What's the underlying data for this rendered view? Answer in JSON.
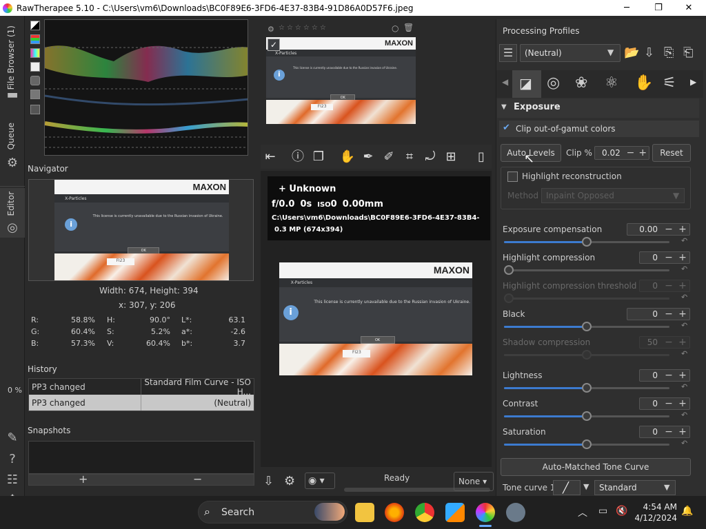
{
  "window": {
    "title": "RawTherapee 5.10 - C:\\Users\\vm6\\Downloads\\BC0F89E6-3FD6-4E37-83B4-91D86A0D57F6.jpeg",
    "minimize": "─",
    "maximize": "❐",
    "close": "✕"
  },
  "vtabs": {
    "file_browser": "File Browser (1)",
    "queue": "Queue",
    "editor": "Editor",
    "zoom_percent": "0 %"
  },
  "navigator": {
    "title": "Navigator",
    "size_text": "Width: 674, Height: 394",
    "coords_text": "x: 307, y: 206",
    "r_label": "R:",
    "r_value": "58.8%",
    "g_label": "G:",
    "g_value": "60.4%",
    "b_label": "B:",
    "b_value": "57.3%",
    "h_label": "H:",
    "h_value": "90.0°",
    "s_label": "S:",
    "s_value": "5.2%",
    "v_label": "V:",
    "v_value": "60.4%",
    "l_label": "L*:",
    "l_value": "63.1",
    "a_label": "a*:",
    "a_value": "-2.6",
    "bb_label": "b*:",
    "bb_value": "3.7"
  },
  "history": {
    "title": "History",
    "rows": [
      {
        "action": "PP3 changed",
        "value": "Standard Film Curve - ISO H..."
      },
      {
        "action": "PP3 changed",
        "value": "(Neutral)"
      }
    ]
  },
  "snapshots": {
    "title": "Snapshots",
    "add": "+",
    "remove": "−"
  },
  "thumbnail_image": {
    "brand": "MAXON",
    "app": "X-Particles",
    "message": "This license is currently unavailable due to the Russian invasion of Ukraine.",
    "ok": "OK",
    "tag": "FI23"
  },
  "exif": {
    "camera": "+  Unknown",
    "fnum": "f/0.0",
    "shutter": "0s",
    "iso_label": "ISO",
    "iso": "0",
    "focal": "0.00mm",
    "path": "C:\\Users\\vm6\\Downloads\\BC0F89E6-3FD6-4E37-83B4-",
    "mp": "0.3 MP (674x394)"
  },
  "status": {
    "text": "Ready",
    "none_select": "None"
  },
  "processing": {
    "title": "Processing Profiles",
    "profile": "(Neutral)"
  },
  "exposure": {
    "section_title": "Exposure",
    "clip_gamut": "Clip out-of-gamut colors",
    "auto_levels": "Auto Levels",
    "clip_label": "Clip %",
    "clip_value": "0.02",
    "reset": "Reset",
    "highlight_recon": "Highlight reconstruction",
    "method_label": "Method",
    "method_value": "Inpaint Opposed",
    "sliders": [
      {
        "label": "Exposure compensation",
        "value": "0.00",
        "dim": false,
        "pos": 0.5
      },
      {
        "label": "Highlight compression",
        "value": "0",
        "dim": false,
        "pos": 0.0
      },
      {
        "label": "Highlight compression threshold",
        "value": "0",
        "dim": true,
        "pos": 0.0
      },
      {
        "label": "Black",
        "value": "0",
        "dim": false,
        "pos": 0.5
      },
      {
        "label": "Shadow compression",
        "value": "50",
        "dim": true,
        "pos": 0.5
      },
      {
        "label": "Lightness",
        "value": "0",
        "dim": false,
        "pos": 0.5
      },
      {
        "label": "Contrast",
        "value": "0",
        "dim": false,
        "pos": 0.5
      },
      {
        "label": "Saturation",
        "value": "0",
        "dim": false,
        "pos": 0.5
      }
    ],
    "auto_tone": "Auto-Matched Tone Curve",
    "tone_curve_label": "Tone curve 1:",
    "tone_curve_value": "Standard"
  },
  "taskbar": {
    "search": "Search",
    "time": "4:54 AM",
    "date": "4/12/2024"
  },
  "colors": {
    "accent": "#3c7bd0",
    "panel": "#2f2f2f"
  }
}
